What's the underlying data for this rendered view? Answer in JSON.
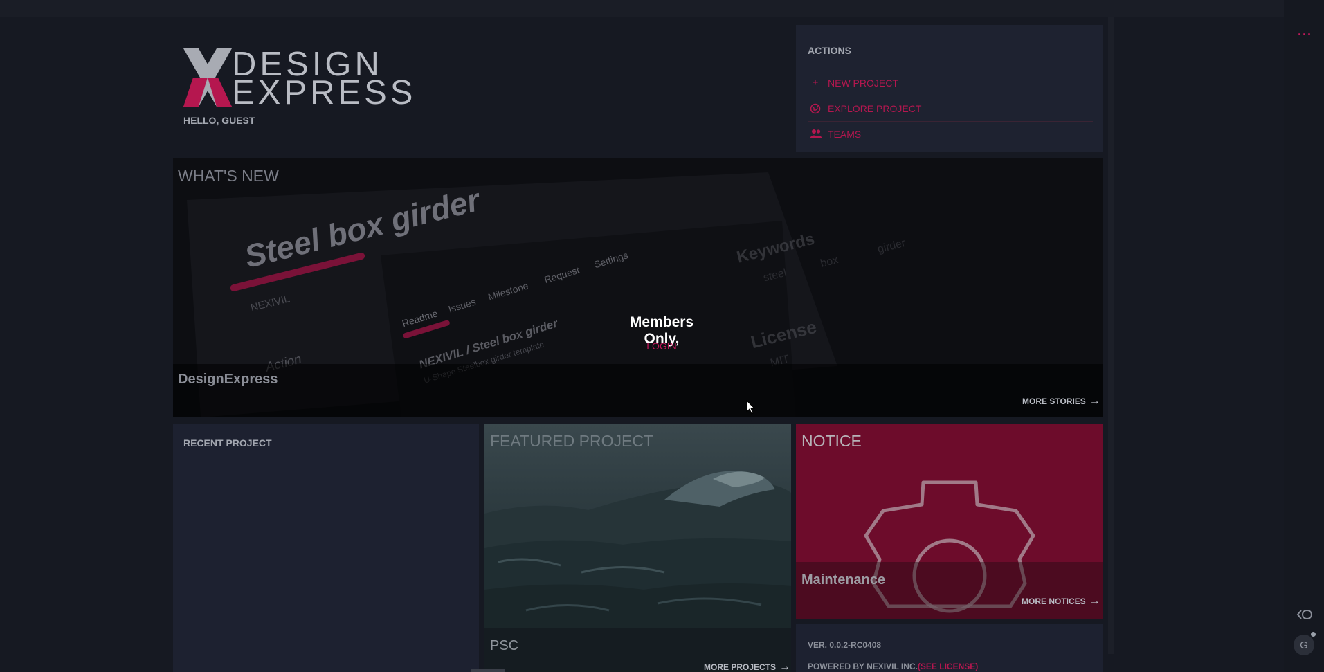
{
  "header": {
    "logo_alt": "X DESIGN EXPRESS",
    "logo_line1": "DESIGN",
    "logo_line2": "EXPRESS",
    "greeting": "HELLO, GUEST"
  },
  "actions": {
    "title": "ACTIONS",
    "items": [
      {
        "label": "NEW PROJECT",
        "icon": "plus-icon"
      },
      {
        "label": "EXPLORE PROJECT",
        "icon": "globe-icon"
      },
      {
        "label": "TEAMS",
        "icon": "people-icon"
      }
    ]
  },
  "whats_new": {
    "title": "WHAT'S NEW",
    "caption": "DesignExpress",
    "more_label": "MORE STORIES",
    "overlay_title": "Members Only,",
    "overlay_login": "LOGIN",
    "background_texts": {
      "headline": "Steel box girder",
      "org": "NEXIVIL",
      "action": "Action",
      "tabs": [
        "Readme",
        "Issues",
        "Milestone",
        "Request",
        "Settings"
      ],
      "repo": "NEXIVIL / Steel box girder",
      "repo_desc": "U-Shape Steelbox girder template",
      "keywords_label": "Keywords",
      "keywords": [
        "steel",
        "box",
        "girder"
      ],
      "license_label": "License",
      "license_value": "MIT"
    }
  },
  "recent_project": {
    "title": "RECENT PROJECT"
  },
  "featured_project": {
    "title": "FEATURED PROJECT",
    "caption": "PSC",
    "more_label": "MORE PROJECTS"
  },
  "notice": {
    "title": "NOTICE",
    "caption": "Maintenance",
    "more_label": "MORE NOTICES",
    "icon": "gear-icon"
  },
  "footer": {
    "version": "VER. 0.0.2-RC0408",
    "powered_prefix": "POWERED BY NEXIVIL INC.",
    "powered_license": "(SEE LICENSE)"
  },
  "rail": {
    "more_icon": "more-icon",
    "collapse_icon": "collapse-icon",
    "avatar_letter": "G"
  },
  "colors": {
    "accent": "#c2185b",
    "background": "#161922",
    "panel": "#1e2230",
    "notice": "#6d0c2b"
  }
}
